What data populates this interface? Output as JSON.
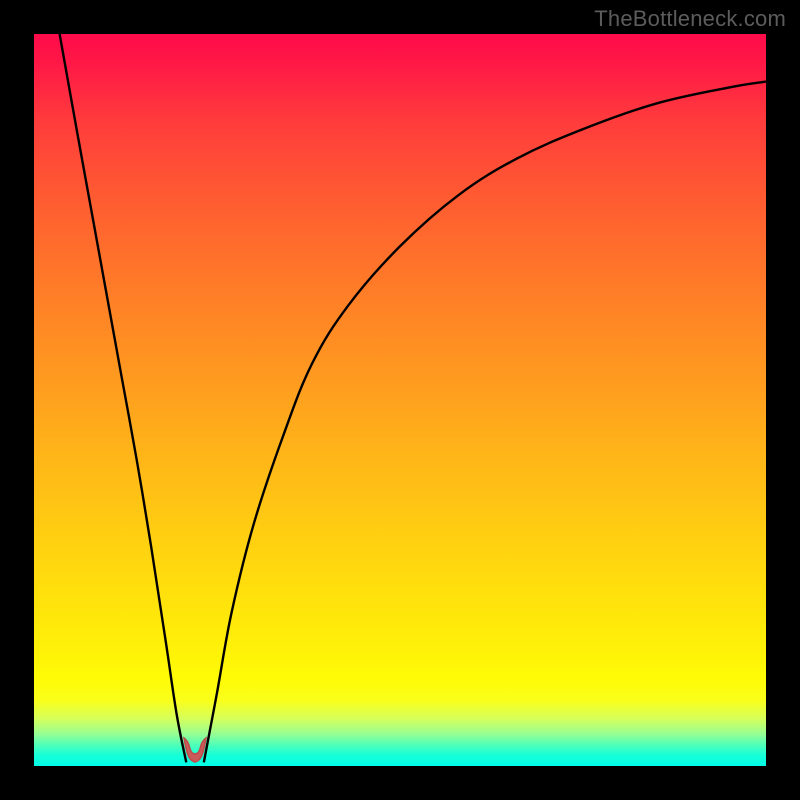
{
  "attribution": "TheBottleneck.com",
  "colors": {
    "frame": "#000000",
    "curve": "#000000",
    "marker_fill": "#cb5a5a",
    "marker_stroke": "#bf4a4a"
  },
  "chart_data": {
    "type": "line",
    "title": "",
    "xlabel": "",
    "ylabel": "",
    "xlim": [
      0,
      100
    ],
    "ylim": [
      0,
      100
    ],
    "series": [
      {
        "name": "left-branch",
        "x": [
          3.5,
          6,
          8,
          10,
          12,
          14,
          16,
          18,
          19.5,
          20.8
        ],
        "values": [
          100,
          86,
          75,
          64,
          53,
          42,
          30,
          17,
          7,
          0.5
        ]
      },
      {
        "name": "right-branch",
        "x": [
          23.2,
          25,
          27,
          30,
          34,
          38,
          43,
          50,
          58,
          66,
          75,
          85,
          95,
          100
        ],
        "values": [
          0.5,
          10,
          21,
          33,
          45,
          55,
          63,
          71,
          78,
          83,
          87,
          90.5,
          92.7,
          93.5
        ]
      }
    ],
    "marker": {
      "name": "notch-marker",
      "x": 22,
      "y": 0.5
    },
    "background_gradient": {
      "direction": "vertical",
      "stops": [
        {
          "pos": 0,
          "color": "#ff0b4a"
        },
        {
          "pos": 50,
          "color": "#ff9820"
        },
        {
          "pos": 88,
          "color": "#fffb06"
        },
        {
          "pos": 100,
          "color": "#00ffe8"
        }
      ]
    }
  }
}
